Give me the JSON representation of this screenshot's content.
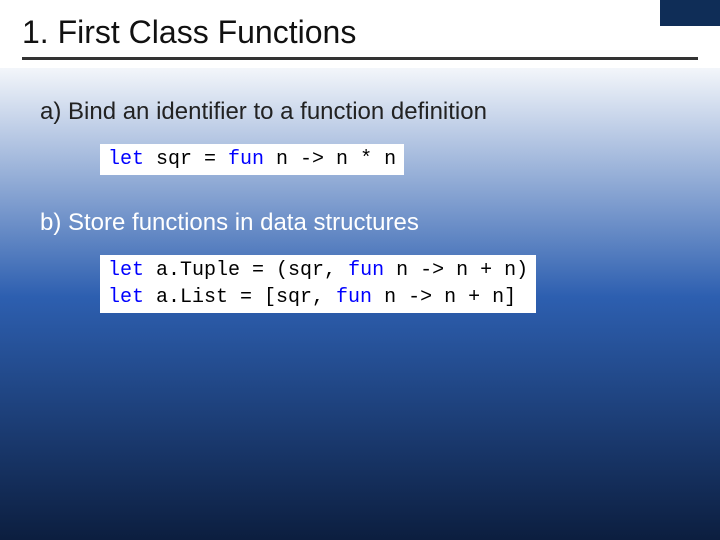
{
  "slide": {
    "title": "1. First Class Functions",
    "sections": [
      {
        "heading": "a) Bind an identifier to a function definition",
        "code_tokens": [
          {
            "t": "let",
            "k": true
          },
          {
            "t": " sqr = "
          },
          {
            "t": "fun",
            "k": true
          },
          {
            "t": " n -> n * n"
          }
        ]
      },
      {
        "heading": "b) Store functions in data structures",
        "code_tokens": [
          {
            "t": "let",
            "k": true
          },
          {
            "t": " a.Tuple = (sqr, "
          },
          {
            "t": "fun",
            "k": true
          },
          {
            "t": " n -> n + n)\n"
          },
          {
            "t": "let",
            "k": true
          },
          {
            "t": " a.List = [sqr, "
          },
          {
            "t": "fun",
            "k": true
          },
          {
            "t": " n -> n + n]"
          }
        ]
      }
    ]
  }
}
